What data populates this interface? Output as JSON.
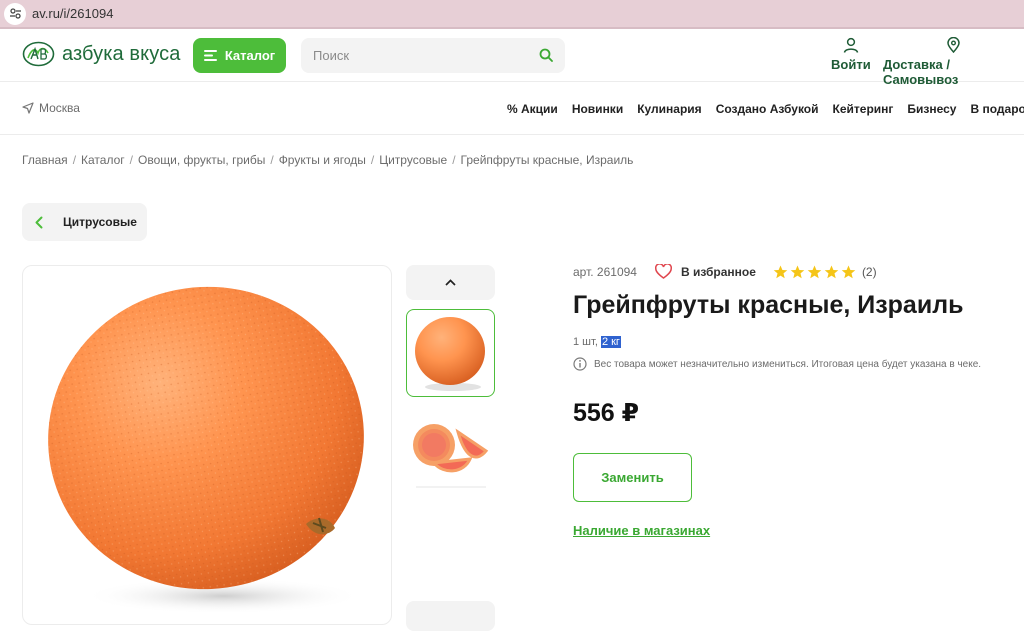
{
  "browser": {
    "url": "av.ru/i/261094",
    "site_icon": "tune-icon"
  },
  "header": {
    "logo_text": "азбука вкуса",
    "catalog_label": "Каталог",
    "search_placeholder": "Поиск",
    "login_label": "Войти",
    "delivery_label": "Доставка / Самовывоз"
  },
  "nav": {
    "city": "Москва",
    "links": [
      "% Акции",
      "Новинки",
      "Кулинария",
      "Создано Азбукой",
      "Кейтеринг",
      "Бизнесу"
    ],
    "gift": "В подарок"
  },
  "breadcrumb": {
    "items": [
      "Главная",
      "Каталог",
      "Овощи, фрукты, грибы",
      "Фрукты и ягоды",
      "Цитрусовые",
      "Грейпфруты красные, Израиль"
    ],
    "separator": "/"
  },
  "back_label": "Цитрусовые",
  "product": {
    "article": "арт. 261094",
    "favorite_label": "В избранное",
    "rating": 5,
    "rating_max": 5,
    "reviews_count": "(2)",
    "title": "Грейпфруты красные, Израиль",
    "unit_text": "1 шт,",
    "unit_weight": "2 кг",
    "weight_note": "Вес товара может незначительно измениться. Итоговая цена будет указана в чеке.",
    "price": "556 ₽",
    "replace_label": "Заменить",
    "stores_link": "Наличие в магазинах"
  },
  "colors": {
    "brand_green": "#4dbd3a",
    "logo_green": "#1f6b3a",
    "star_yellow": "#f5c518",
    "heart_red": "#e0464e",
    "selection_blue": "#2f62cf"
  }
}
